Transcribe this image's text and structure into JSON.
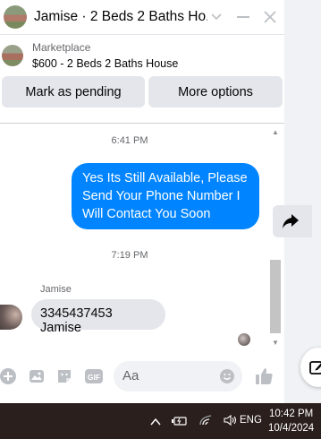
{
  "header": {
    "title": "Jamise · 2 Beds 2 Baths Ho...",
    "icons": [
      "chevron-down-icon",
      "minimize-icon",
      "close-icon"
    ]
  },
  "listing": {
    "label": "Marketplace",
    "item": "$600 - 2 Beds 2 Baths House"
  },
  "actions": {
    "pending_label": "Mark as pending",
    "more_label": "More options"
  },
  "messages": {
    "time1": "6:41 PM",
    "outgoing_text": "Yes Its Still Available, Please Send Your Phone Number I Will Contact You Soon",
    "time2": "7:19 PM",
    "sender_name": "Jamise",
    "incoming_text": "3345437453 Jamise"
  },
  "composer": {
    "placeholder": "Aa",
    "icons": [
      "plus-icon",
      "photo-icon",
      "sticker-icon",
      "gif-icon",
      "emoji-icon",
      "like-icon"
    ],
    "gif_text": "GIF"
  },
  "taskbar": {
    "language": "ENG",
    "time": "10:42 PM",
    "date": "10/4/2024"
  },
  "colors": {
    "accent": "#0084ff",
    "bubble_in": "#e4e6eb",
    "taskbar": "#2a1f1c"
  }
}
